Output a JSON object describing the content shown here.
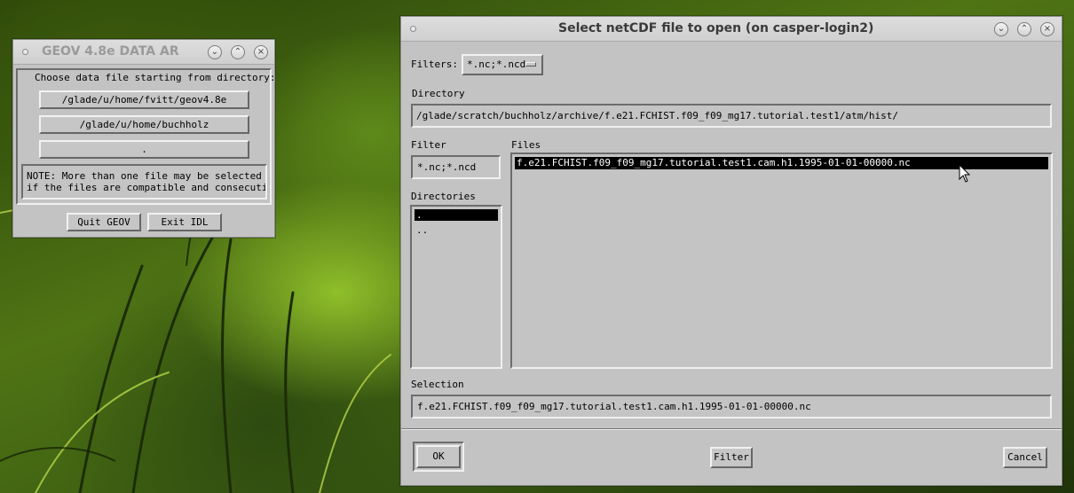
{
  "colors": {
    "desktop": "#3d5f12",
    "window": "#c3c3c3",
    "highlight": "#000000"
  },
  "geov": {
    "title": "GEOV 4.8e DATA AR",
    "prompt": "Choose data file starting from directory:",
    "dir_buttons": [
      "/glade/u/home/fvitt/geov4.8e",
      "/glade/u/home/buchholz",
      "."
    ],
    "note_line1": "NOTE: More than one file may be selected",
    "note_line2": "if the files are compatible and consecutive.",
    "quit_label": "Quit GEOV",
    "exit_label": "Exit IDL",
    "icons": [
      "menu-dot-icon",
      "minimize-icon",
      "maximize-icon",
      "close-icon"
    ]
  },
  "dialog": {
    "title": "Select netCDF file to open (on casper-login2)",
    "filters_label": "Filters:",
    "filters_value": "*.nc;*.ncd",
    "directory_label": "Directory",
    "directory_value": "/glade/scratch/buchholz/archive/f.e21.FCHIST.f09_f09_mg17.tutorial.test1/atm/hist/",
    "filter_label": "Filter",
    "filter_value": "*.nc;*.ncd",
    "files_label": "Files",
    "files": [
      "f.e21.FCHIST.f09_f09_mg17.tutorial.test1.cam.h1.1995-01-01-00000.nc"
    ],
    "directories_label": "Directories",
    "directories": [
      ".",
      ".."
    ],
    "selection_label": "Selection",
    "selection_value": "f.e21.FCHIST.f09_f09_mg17.tutorial.test1.cam.h1.1995-01-01-00000.nc",
    "ok_label": "OK",
    "filter_button_label": "Filter",
    "cancel_label": "Cancel",
    "icons": [
      "menu-dot-icon",
      "minimize-icon",
      "maximize-icon",
      "close-icon",
      "dropdown-indicator-icon",
      "mouse-pointer-icon"
    ]
  }
}
